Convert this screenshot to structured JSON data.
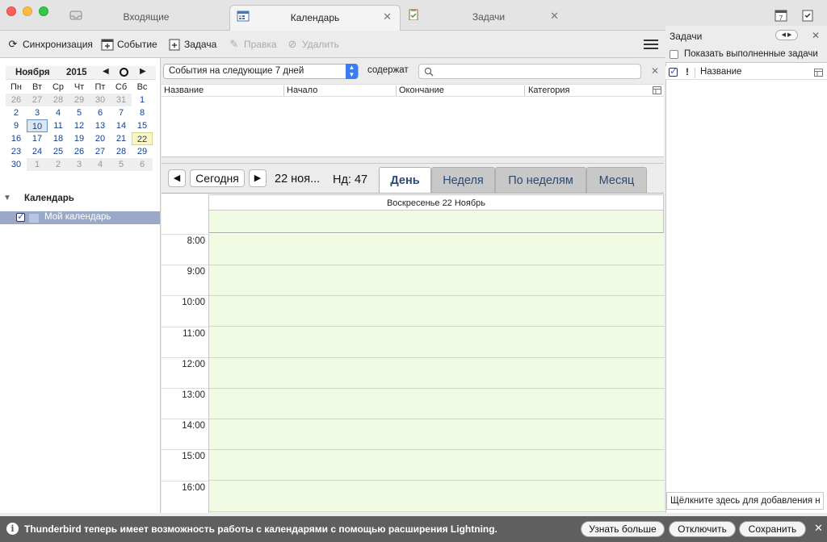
{
  "tabs": [
    {
      "label": "Входящие",
      "icon": "inbox-icon"
    },
    {
      "label": "Календарь",
      "icon": "calendar-icon"
    },
    {
      "label": "Задачи",
      "icon": "tasks-icon"
    }
  ],
  "toolbar": {
    "sync": "Синхронизация",
    "event": "Событие",
    "task": "Задача",
    "edit": "Правка",
    "delete": "Удалить"
  },
  "minical": {
    "month": "Ноября",
    "year": "2015",
    "weekdays": [
      "Пн",
      "Вт",
      "Ср",
      "Чт",
      "Пт",
      "Сб",
      "Вс"
    ],
    "weeks": [
      [
        "26",
        "27",
        "28",
        "29",
        "30",
        "31",
        "1"
      ],
      [
        "2",
        "3",
        "4",
        "5",
        "6",
        "7",
        "8"
      ],
      [
        "9",
        "10",
        "11",
        "12",
        "13",
        "14",
        "15"
      ],
      [
        "16",
        "17",
        "18",
        "19",
        "20",
        "21",
        "22"
      ],
      [
        "23",
        "24",
        "25",
        "26",
        "27",
        "28",
        "29"
      ],
      [
        "30",
        "1",
        "2",
        "3",
        "4",
        "5",
        "6"
      ]
    ],
    "selected": "10",
    "today": "22"
  },
  "calendars": {
    "header": "Календарь",
    "items": [
      {
        "name": "Мой календарь",
        "checked": true
      }
    ]
  },
  "filter": {
    "selected": "События на следующие 7 дней",
    "contains_label": "содержат",
    "search_value": ""
  },
  "event_list": {
    "columns": [
      "Название",
      "Начало",
      "Окончание",
      "Категория"
    ]
  },
  "view": {
    "today_label": "Сегодня",
    "date": "22 ноя...",
    "week": "Нд: 47",
    "tabs": [
      "День",
      "Неделя",
      "По неделям",
      "Месяц"
    ],
    "active_tab": "День",
    "day_header": "Воскресенье 22 Ноябрь",
    "hours": [
      "8:00",
      "9:00",
      "10:00",
      "11:00",
      "12:00",
      "13:00",
      "14:00",
      "15:00",
      "16:00"
    ]
  },
  "tasks_pane": {
    "title": "Задачи",
    "show_completed": "Показать выполненные задачи",
    "column_name": "Название",
    "quick_add": "Щёлкните здесь для добавления н"
  },
  "notification": {
    "text": "Thunderbird теперь имеет возможность работы с календарями с помощью расширения Lightning.",
    "learn_more": "Узнать больше",
    "disable": "Отключить",
    "keep": "Сохранить"
  },
  "colors": {
    "grid_bg": "#f1fbe4",
    "today_bg": "#fbf6c4",
    "selection": "#9aa9c8",
    "notification_bg": "#5f5f5f"
  }
}
